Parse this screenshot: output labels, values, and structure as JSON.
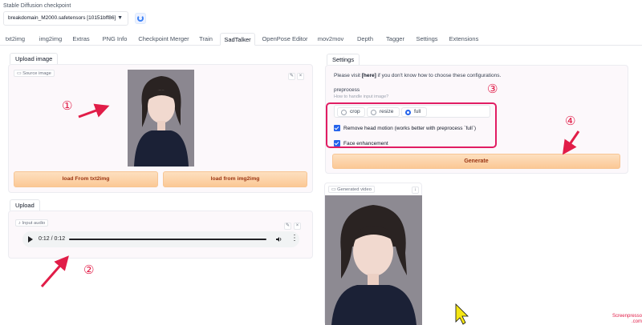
{
  "checkpoint": {
    "label": "Stable Diffusion checkpoint",
    "value": "breakdomain_M2000.safetensors [10151bff86]"
  },
  "tabs": [
    "txt2img",
    "img2img",
    "Extras",
    "PNG Info",
    "Checkpoint Merger",
    "Train",
    "SadTalker",
    "OpenPose Editor",
    "mov2mov",
    "Depth",
    "Tagger",
    "Settings",
    "Extensions"
  ],
  "active_tab": "SadTalker",
  "upload_image": {
    "tab_label": "Upload image",
    "field_label": "Source image",
    "load_txt2img": "load From txt2img",
    "load_img2img": "load from img2img"
  },
  "upload_audio": {
    "tab_label": "Upload",
    "field_label": "Input audio",
    "time": "0:12 / 0:12",
    "progress": 1.0
  },
  "settings": {
    "tab_label": "Settings",
    "visit_prefix": "Please visit ",
    "visit_link": "[here]",
    "visit_suffix": " if you don't know how to choose these configurations.",
    "preprocess_label": "preprocess",
    "preprocess_hint": "How to handle input image?",
    "options": [
      "crop",
      "resize",
      "full"
    ],
    "selected": "full",
    "remove_head_motion": "Remove head motion (works better with preprocess `full`)",
    "face_enhancement": "Face enhancement",
    "generate": "Generate"
  },
  "output": {
    "field_label": "Generated video"
  },
  "annotations": {
    "n1": "①",
    "n2": "②",
    "n3": "③",
    "n4": "④",
    "color": "#e11d48"
  },
  "watermark": {
    "line1": "Screenpresso",
    "line2": ".com"
  }
}
